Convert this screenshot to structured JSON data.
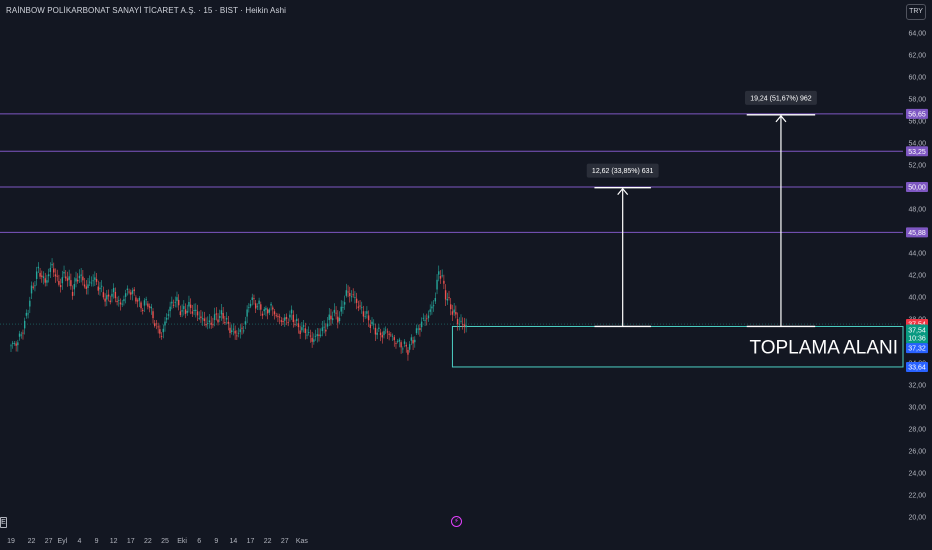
{
  "header": {
    "title": "RAİNBOW POLİKARBONAT SANAYİ TİCARET A.Ş. · 15 · BIST · Heikin Ashi",
    "currency": "TRY"
  },
  "colors": {
    "background": "#131722",
    "up": "#26a69a",
    "down": "#ef5350",
    "resistance": "#7e57c2",
    "zone": "#4dd0c4",
    "axis_text": "#b2b5be",
    "measure": "#ffffff",
    "label_red": "#f23645",
    "label_green": "#089981",
    "label_blue": "#2962ff",
    "label_purple": "#7e57c2"
  },
  "icons": {
    "flash": "lightning-icon",
    "e_badge": "E"
  },
  "chart_data": {
    "type": "candlestick",
    "style": "Heikin Ashi",
    "interval": "15",
    "ylim": [
      19.5,
      65
    ],
    "y_ticks": [
      "64,00",
      "62,00",
      "60,00",
      "58,00",
      "56,00",
      "54,00",
      "52,00",
      "50,00",
      "48,00",
      "46,00",
      "44,00",
      "42,00",
      "40,00",
      "38,00",
      "36,00",
      "34,00",
      "32,00",
      "30,00",
      "28,00",
      "26,00",
      "24,00",
      "22,00",
      "20,00"
    ],
    "y_tick_values": [
      64,
      62,
      60,
      58,
      56,
      54,
      52,
      50,
      48,
      46,
      44,
      42,
      40,
      38,
      36,
      34,
      32,
      30,
      28,
      26,
      24,
      22,
      20
    ],
    "x_ticks": [
      "19",
      "22",
      "27",
      "Eyl",
      "4",
      "9",
      "12",
      "17",
      "22",
      "25",
      "Eki",
      "6",
      "9",
      "14",
      "17",
      "22",
      "27",
      "Kas"
    ],
    "x_tick_index": [
      0,
      12,
      22,
      30,
      40,
      50,
      60,
      70,
      80,
      90,
      100,
      110,
      120,
      130,
      140,
      150,
      160,
      170
    ],
    "price_path": [
      [
        0,
        35.6
      ],
      [
        4,
        35.9
      ],
      [
        8,
        37.5
      ],
      [
        12,
        40.5
      ],
      [
        16,
        42.5
      ],
      [
        20,
        41.3
      ],
      [
        24,
        42.9
      ],
      [
        28,
        41.1
      ],
      [
        32,
        42.1
      ],
      [
        36,
        40.6
      ],
      [
        40,
        42.1
      ],
      [
        44,
        40.8
      ],
      [
        48,
        41.7
      ],
      [
        52,
        40.8
      ],
      [
        56,
        39.7
      ],
      [
        60,
        40.4
      ],
      [
        64,
        39.2
      ],
      [
        68,
        40.6
      ],
      [
        72,
        40.3
      ],
      [
        76,
        39.1
      ],
      [
        80,
        39.6
      ],
      [
        84,
        37.7
      ],
      [
        88,
        36.5
      ],
      [
        92,
        38.7
      ],
      [
        96,
        39.8
      ],
      [
        100,
        38.6
      ],
      [
        104,
        39.1
      ],
      [
        108,
        38.6
      ],
      [
        112,
        37.9
      ],
      [
        116,
        37.5
      ],
      [
        120,
        38.2
      ],
      [
        124,
        38.3
      ],
      [
        128,
        37.1
      ],
      [
        132,
        36.6
      ],
      [
        136,
        37.2
      ],
      [
        140,
        39.8
      ],
      [
        144,
        39.3
      ],
      [
        148,
        38.6
      ],
      [
        152,
        39.1
      ],
      [
        156,
        38.1
      ],
      [
        160,
        37.8
      ],
      [
        164,
        38.4
      ],
      [
        168,
        37.2
      ],
      [
        172,
        37.0
      ],
      [
        176,
        36.1
      ],
      [
        180,
        36.6
      ],
      [
        184,
        37.3
      ],
      [
        188,
        38.5
      ],
      [
        192,
        38.1
      ],
      [
        196,
        40.4
      ],
      [
        200,
        40.1
      ],
      [
        204,
        39.0
      ],
      [
        208,
        38.2
      ],
      [
        212,
        37.2
      ],
      [
        216,
        36.6
      ],
      [
        220,
        36.9
      ],
      [
        224,
        36.1
      ],
      [
        228,
        35.7
      ],
      [
        232,
        35.3
      ],
      [
        236,
        36.4
      ],
      [
        240,
        37.7
      ],
      [
        244,
        38.3
      ],
      [
        248,
        39.9
      ],
      [
        250,
        42.5
      ],
      [
        252,
        41.6
      ],
      [
        254,
        40.3
      ],
      [
        256,
        39.4
      ],
      [
        258,
        38.8
      ],
      [
        260,
        38.2
      ],
      [
        262,
        37.6
      ],
      [
        264,
        37.5
      ],
      [
        266,
        37.45
      ]
    ],
    "resistance_lines": [
      {
        "value": 56.65,
        "label": "56,65"
      },
      {
        "value": 53.25,
        "label": "53,25"
      },
      {
        "value": 50.0,
        "label": "50,00"
      },
      {
        "value": 45.88,
        "label": "45,88"
      }
    ],
    "price_labels": [
      {
        "text": "37,54",
        "value": 37.54,
        "color_key": "label_red"
      },
      {
        "text": "37,54",
        "value": 36.95,
        "color_key": "label_green",
        "sub": "10:36"
      },
      {
        "text": "37,32",
        "value": 35.35,
        "color_key": "label_blue"
      },
      {
        "text": "33,64",
        "value": 33.64,
        "color_key": "label_blue"
      }
    ],
    "accumulation_zone": {
      "label": "TOPLAMA ALANI",
      "from_index": 258,
      "top": 37.32,
      "bottom": 33.64
    },
    "measurements": [
      {
        "label": "12,62 (33,85%) 631",
        "base": 37.32,
        "target": 49.94,
        "from_index": 341,
        "to_index": 374
      },
      {
        "label": "19,24 (51,67%) 962",
        "base": 37.32,
        "target": 56.56,
        "from_index": 430,
        "to_index": 470
      }
    ]
  }
}
